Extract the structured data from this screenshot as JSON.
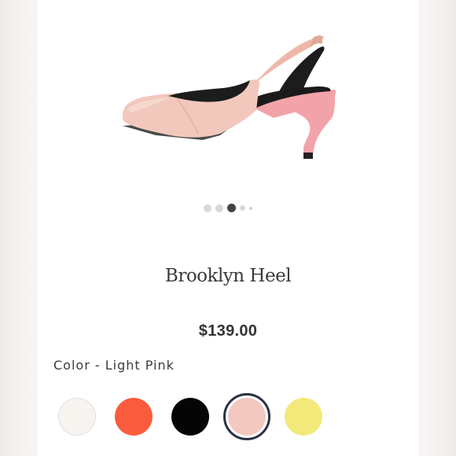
{
  "product": {
    "title": "Brooklyn Heel",
    "price": "$139.00",
    "image_icon": "shoe-product-image"
  },
  "carousel": {
    "count": 5,
    "active_index": 3
  },
  "color": {
    "label_prefix": "Color - ",
    "selected_name": "Light Pink",
    "swatches": [
      {
        "icon": "swatch-circle",
        "hex": "#f7f3ef"
      },
      {
        "icon": "swatch-circle",
        "hex": "#fb5b3d"
      },
      {
        "icon": "swatch-circle",
        "hex": "#050505"
      },
      {
        "icon": "swatch-circle",
        "hex": "#f2c8c0"
      },
      {
        "icon": "swatch-circle",
        "hex": "#f3e97a"
      }
    ],
    "selected_index": 4
  }
}
